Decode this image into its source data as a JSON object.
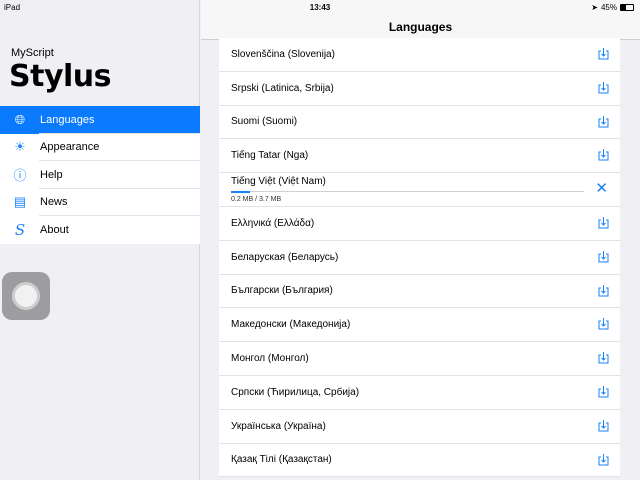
{
  "status": {
    "device": "iPad",
    "time": "13:43",
    "battery": "45%",
    "battery_level": 0.45
  },
  "sidebar": {
    "brand_small": "MyScript",
    "brand_big": "Stylus",
    "items": [
      {
        "label": "Languages",
        "icon": "globe-icon"
      },
      {
        "label": "Appearance",
        "icon": "brightness-icon"
      },
      {
        "label": "Help",
        "icon": "help-icon"
      },
      {
        "label": "News",
        "icon": "newspaper-icon"
      },
      {
        "label": "About",
        "icon": "stylus-s-icon"
      }
    ]
  },
  "nav": {
    "title": "Languages"
  },
  "languages": [
    {
      "name": "Slovenščina (Slovenija)"
    },
    {
      "name": "Srpski (Latinica, Srbija)"
    },
    {
      "name": "Suomi (Suomi)"
    },
    {
      "name": "Tiếng Tatar (Nga)"
    },
    {
      "name": "Tiếng Việt (Việt Nam)",
      "progress_text": "0.2 MB / 3.7 MB",
      "progress": 0.054
    },
    {
      "name": "Ελληνικά (Ελλάδα)"
    },
    {
      "name": "Беларуская (Беларусь)"
    },
    {
      "name": "Български (България)"
    },
    {
      "name": "Македонски (Македонија)"
    },
    {
      "name": "Монгол (Монгол)"
    },
    {
      "name": "Српски (Ћирилица, Србија)"
    },
    {
      "name": "Українська (Україна)"
    },
    {
      "name": "Қазақ Тілі (Қазақстан)"
    }
  ]
}
